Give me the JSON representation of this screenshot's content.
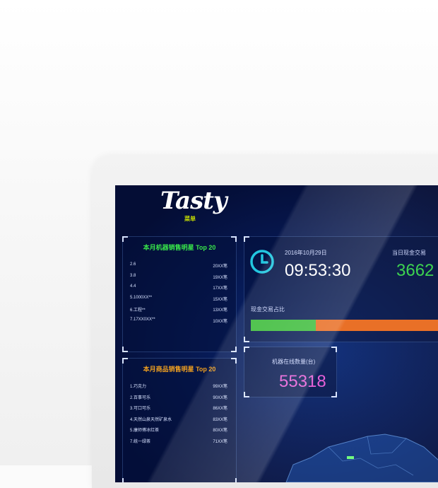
{
  "brand": {
    "logo_text": "Tasty",
    "logo_sub": "菜单"
  },
  "top_panel": {
    "title": "本月机器销售明星 Top 20",
    "title_color": "#39e84a",
    "rows": [
      {
        "name": "2.6",
        "value": "20XX笔"
      },
      {
        "name": "3.8",
        "value": "19XX笔"
      },
      {
        "name": "4.4",
        "value": "17XX笔"
      },
      {
        "name": "5.1000XX**",
        "value": "15XX笔"
      },
      {
        "name": "6.工程**",
        "value": "13XX笔"
      },
      {
        "name": "7.17XX0XX**",
        "value": "10XX笔"
      }
    ]
  },
  "bottom_panel": {
    "title": "本月商品销售明星 Top 20",
    "title_color": "#f0a020",
    "rows": [
      {
        "name": "1.巧克力",
        "value": "99XX笔"
      },
      {
        "name": "2.百事可乐",
        "value": "90XX笔"
      },
      {
        "name": "3.可口可乐",
        "value": "86XX笔"
      },
      {
        "name": "4.天然山泉天然矿泉水",
        "value": "83XX笔"
      },
      {
        "name": "5.康师傅冰红茶",
        "value": "80XX笔"
      },
      {
        "name": "7.统一绿茶",
        "value": "71XX笔"
      }
    ]
  },
  "clock": {
    "date": "2016年10月29日",
    "time": "09:53:30"
  },
  "cash": {
    "label": "当日现金交易",
    "value": "3662"
  },
  "ratio": {
    "label": "现金交易占比",
    "cash_fraction": 0.32
  },
  "online": {
    "label": "机器在线数量(台)",
    "value": "55318"
  }
}
